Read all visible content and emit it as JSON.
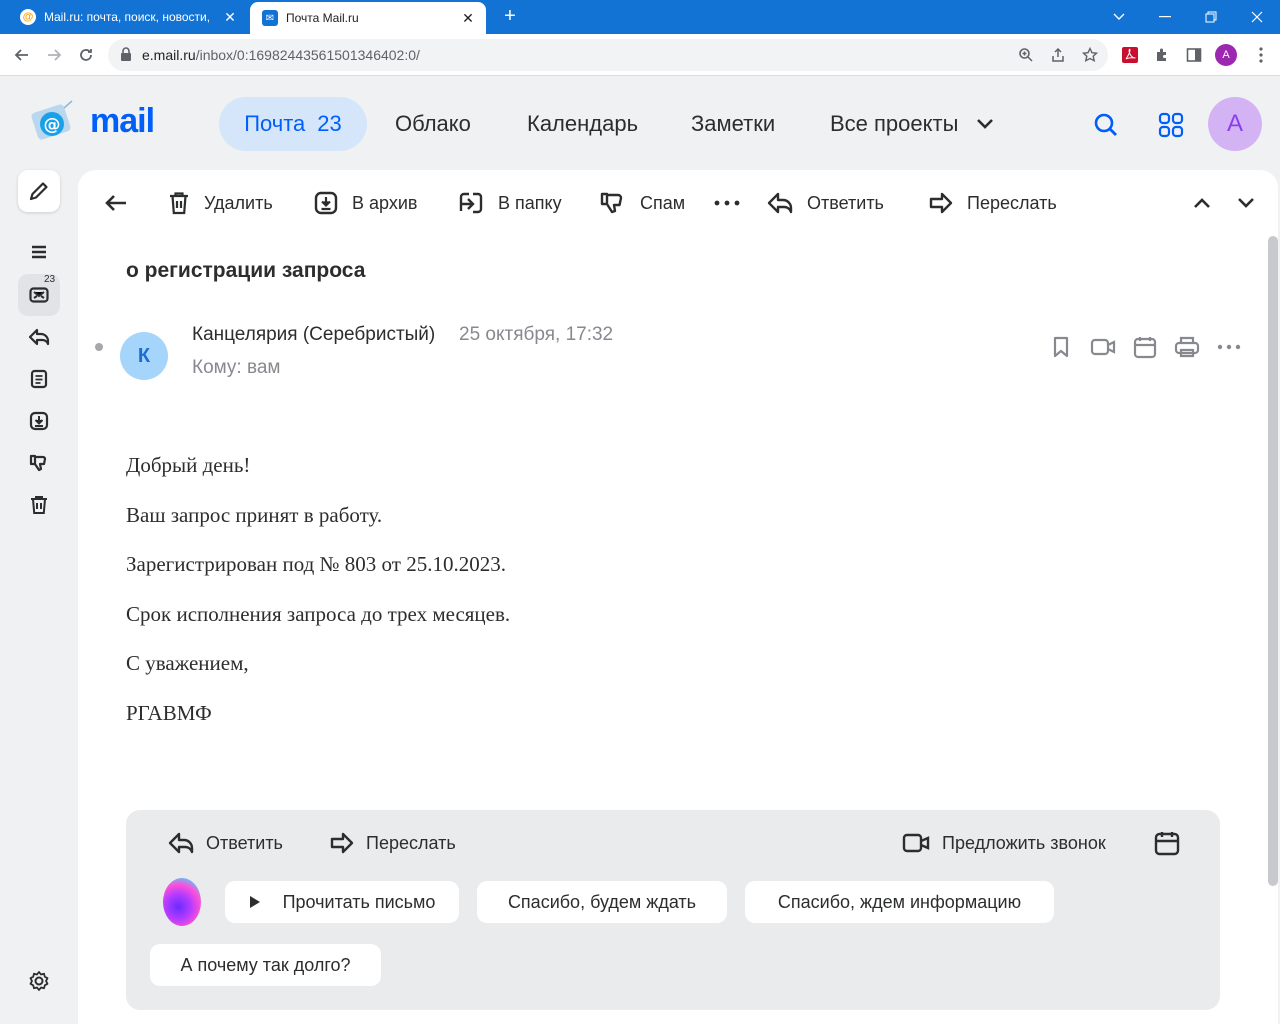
{
  "browser": {
    "tabs": [
      {
        "title": "Mail.ru: почта, поиск, новости, "
      },
      {
        "title": "Почта Mail.ru"
      }
    ],
    "url_host": "e.mail.ru",
    "url_path": "/inbox/0:16982443561501346402:0/",
    "profile_initial": "A"
  },
  "header": {
    "logo_text": "mail",
    "nav": [
      {
        "label": "Почта",
        "count": "23"
      },
      {
        "label": "Облако"
      },
      {
        "label": "Календарь"
      },
      {
        "label": "Заметки"
      },
      {
        "label": "Все проекты"
      }
    ],
    "avatar_initial": "A",
    "accent": "#005ff9"
  },
  "sidebar": {
    "inbox_count": "23"
  },
  "toolbar": {
    "delete": "Удалить",
    "archive": "В архив",
    "move": "В папку",
    "spam": "Спам",
    "more": "•••",
    "reply": "Ответить",
    "forward": "Переслать"
  },
  "message": {
    "subject": "о регистрации запроса",
    "sender_initial": "К",
    "sender": "Канцелярия (Серебристый)",
    "date": "25 октября, 17:32",
    "to": "Кому: вам",
    "body": [
      "Добрый день!",
      "Ваш запрос принят в работу.",
      "Зарегистрирован под № 803 от 25.10.2023.",
      "Срок исполнения запроса до трех месяцев.",
      "С уважением,",
      "РГАВМФ"
    ]
  },
  "reply_panel": {
    "reply": "Ответить",
    "forward": "Переслать",
    "suggest_call": "Предложить звонок",
    "quick_replies": [
      "Прочитать письмо",
      "Спасибо, будем ждать",
      "Спасибо, ждем информацию",
      "А почему так долго?"
    ]
  }
}
